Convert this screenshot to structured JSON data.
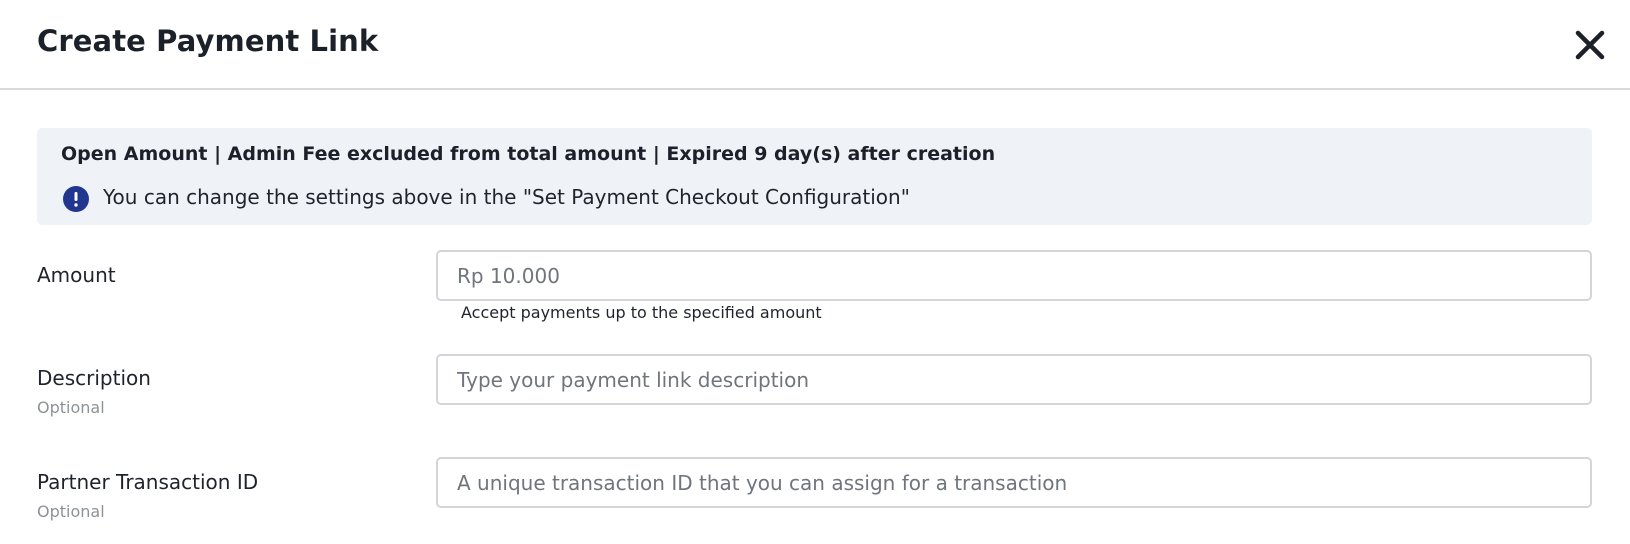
{
  "modal": {
    "title": "Create Payment Link",
    "close_icon": "close-icon"
  },
  "notice": {
    "summary": "Open Amount | Admin Fee excluded from total amount | Expired 9 day(s) after creation",
    "info_icon": "exclamation-circle-icon",
    "message": "You can change the settings above in the \"Set Payment Checkout Configuration\""
  },
  "form": {
    "amount": {
      "label": "Amount",
      "placeholder": "Rp 10.000",
      "helper": "Accept payments up to the specified amount"
    },
    "description": {
      "label": "Description",
      "sublabel": "Optional",
      "placeholder": "Type your payment link description"
    },
    "partner_transaction_id": {
      "label": "Partner Transaction ID",
      "sublabel": "Optional",
      "placeholder": "A unique transaction ID that you can assign for a transaction"
    }
  },
  "colors": {
    "notice_bg": "#eff3f8",
    "info_icon": "#22368f",
    "field_border": "#d3d5d8",
    "muted_text": "#8d9299"
  }
}
